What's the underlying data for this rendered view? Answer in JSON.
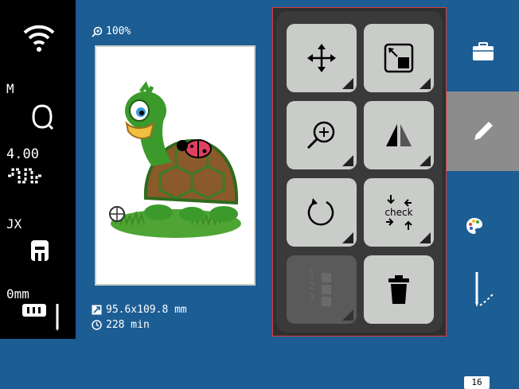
{
  "status": {
    "wifi_icon": "wifi-icon",
    "presser_foot_label": "M",
    "stitch_value": "4.00",
    "foot_label": "JX",
    "needle_label": "0mm"
  },
  "design": {
    "zoom_label": "100%",
    "size_label": "95.6x109.8 mm",
    "time_label": "228 min"
  },
  "edit_panel": {
    "buttons": [
      {
        "name": "move",
        "icon": "move-icon"
      },
      {
        "name": "resize",
        "icon": "resize-icon"
      },
      {
        "name": "zoom",
        "icon": "zoom-in-icon"
      },
      {
        "name": "mirror",
        "icon": "mirror-icon"
      },
      {
        "name": "rotate",
        "icon": "rotate-icon"
      },
      {
        "name": "check",
        "icon": "check-icon",
        "label": "check"
      },
      {
        "name": "order",
        "icon": "order-list-icon",
        "label": "1 2 3"
      },
      {
        "name": "delete",
        "icon": "trash-icon"
      }
    ]
  },
  "right_nav": {
    "color_count": "16"
  },
  "colors": {
    "background": "#1c5d94",
    "panel": "#3a3a3a",
    "button": "#c9ccc9",
    "active_tab": "#8c8c8c",
    "highlight_border": "#e03a3a"
  }
}
